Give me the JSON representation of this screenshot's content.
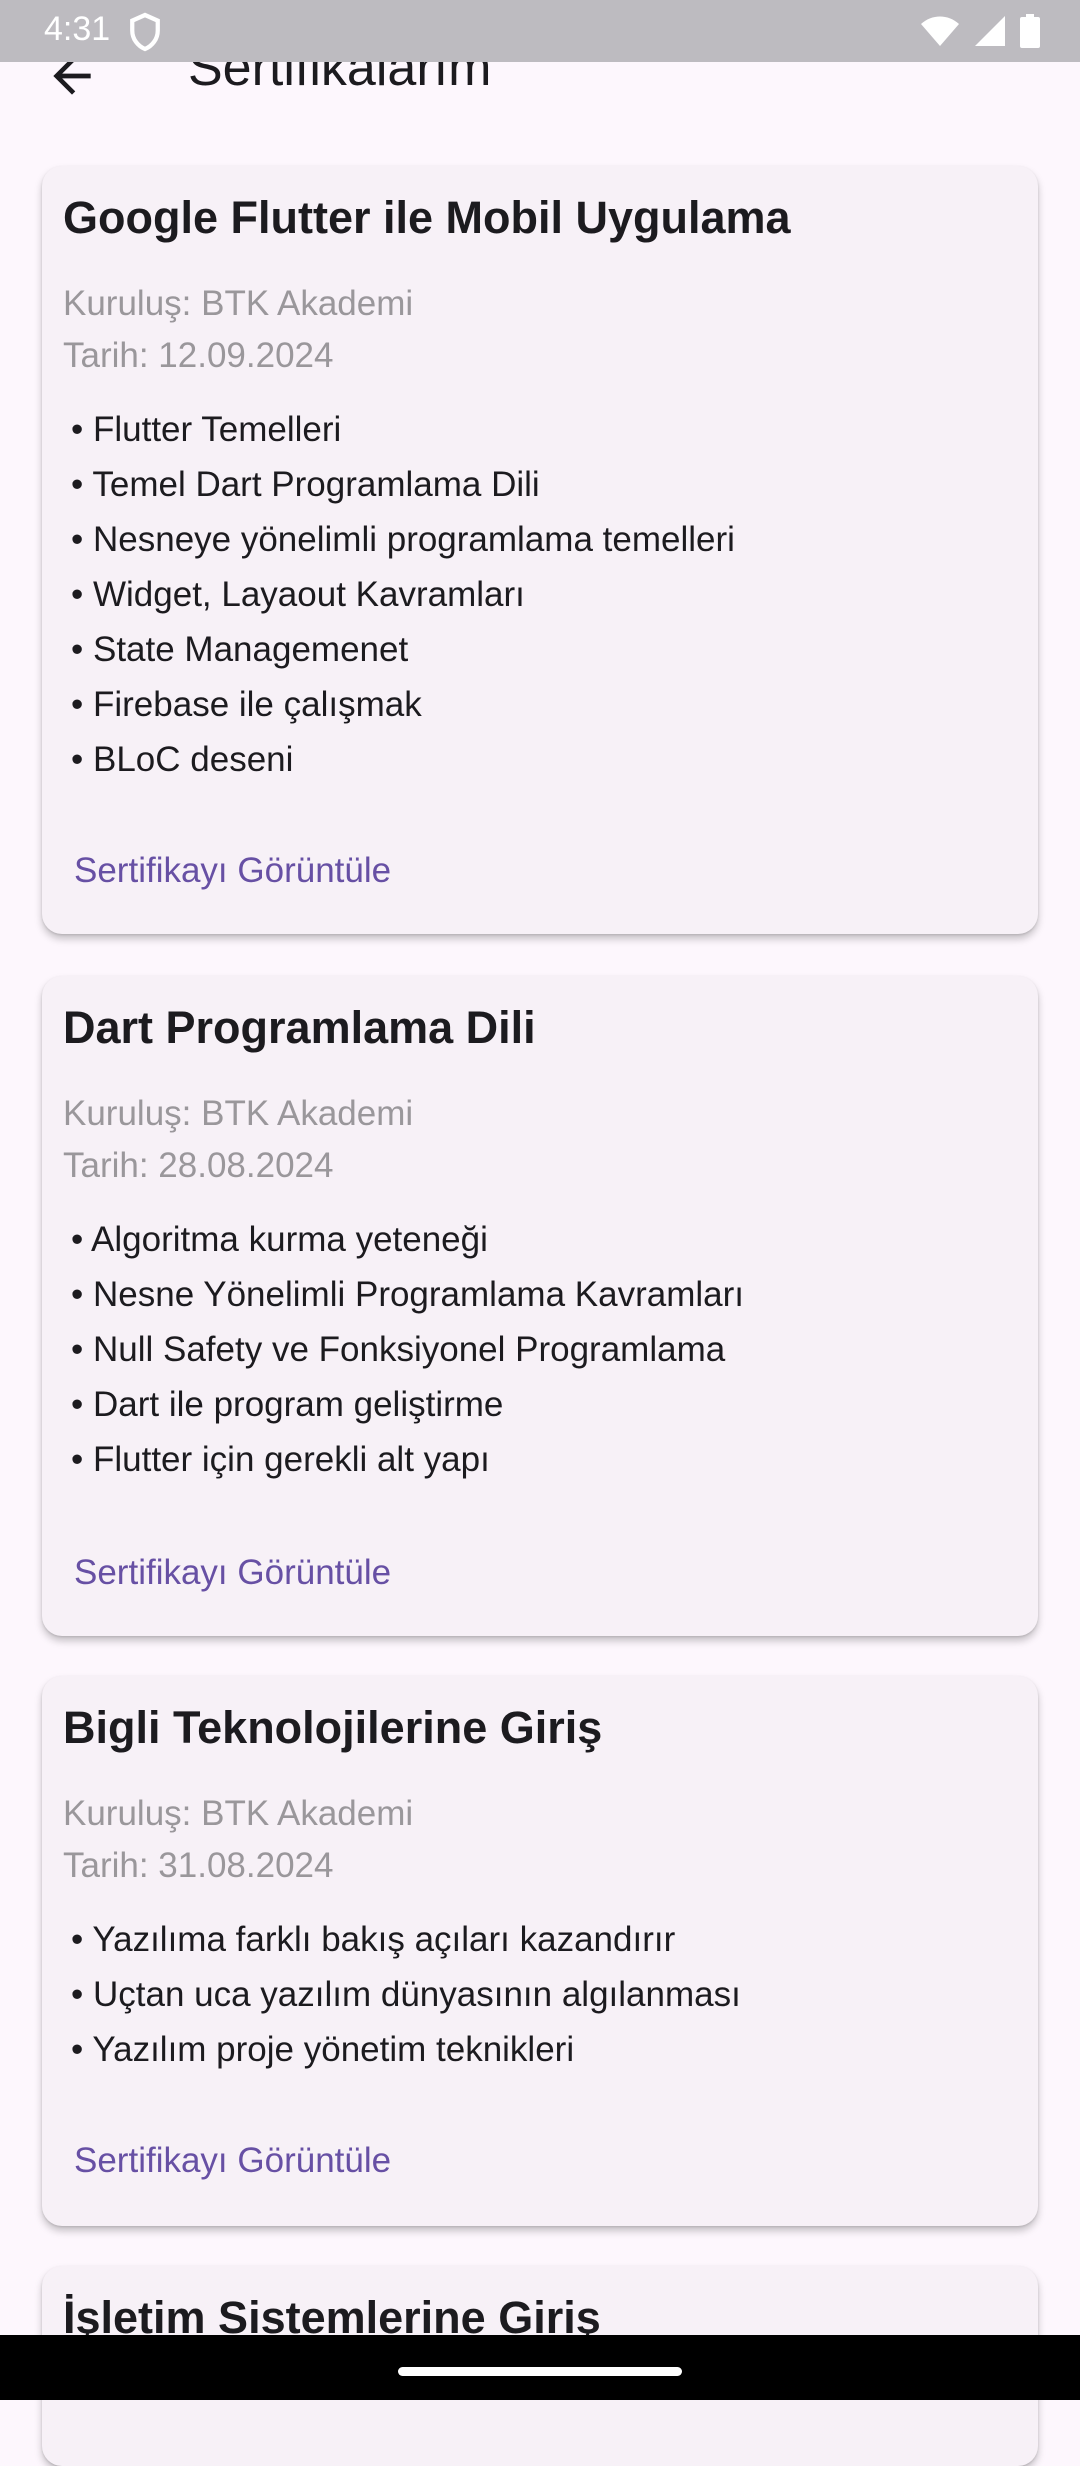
{
  "status_bar": {
    "time": "4:31"
  },
  "app_bar": {
    "title": "Sertifikalarım"
  },
  "certificates": [
    {
      "title": "Google Flutter ile Mobil Uygulama",
      "institution": "Kuruluş: BTK Akademi",
      "date": "Tarih: 12.09.2024",
      "topics": [
        "Flutter Temelleri",
        "Temel Dart Programlama Dili",
        "Nesneye yönelimli programlama temelleri",
        "Widget, Layaout Kavramları",
        "State Managemenet",
        "Firebase ile çalışmak",
        "BLoC deseni"
      ],
      "link_label": "Sertifikayı Görüntüle"
    },
    {
      "title": "Dart Programlama Dili",
      "institution": "Kuruluş: BTK Akademi",
      "date": "Tarih: 28.08.2024",
      "topics": [
        "Algoritma kurma yeteneği",
        "Nesne Yönelimli Programlama Kavramları",
        "Null Safety ve Fonksiyonel Programlama",
        "Dart ile program geliştirme",
        "Flutter için gerekli alt yapı"
      ],
      "link_label": "Sertifikayı Görüntüle"
    },
    {
      "title": "Bigli Teknolojilerine Giriş",
      "institution": "Kuruluş: BTK Akademi",
      "date": "Tarih: 31.08.2024",
      "topics": [
        "Yazılıma farklı bakış açıları kazandırır",
        "Uçtan uca yazılım dünyasının algılanması",
        "Yazılım proje yönetim teknikleri"
      ],
      "link_label": "Sertifikayı Görüntüle"
    },
    {
      "title": "İşletim Sistemlerine Giriş"
    }
  ],
  "colors": {
    "background": "#fdf7fd",
    "card": "#f7f1f7",
    "link": "#6750a4",
    "meta_text": "#9a979b"
  }
}
